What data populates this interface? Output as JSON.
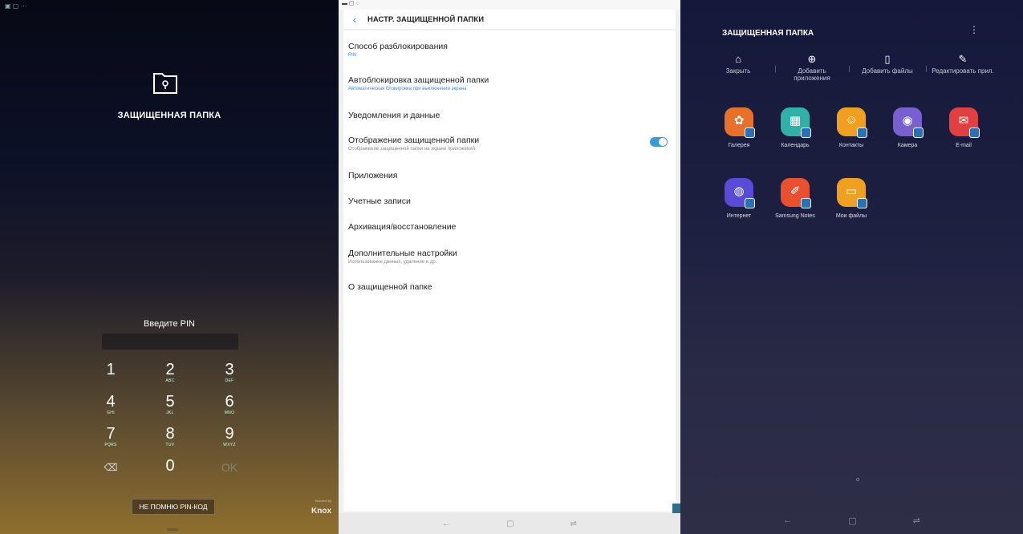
{
  "lock": {
    "title": "ЗАЩИЩЕННАЯ ПАПКА",
    "pin_prompt": "Введите PIN",
    "keys": [
      {
        "digit": "1",
        "letters": ""
      },
      {
        "digit": "2",
        "letters": "ABC"
      },
      {
        "digit": "3",
        "letters": "DEF"
      },
      {
        "digit": "4",
        "letters": "GHI"
      },
      {
        "digit": "5",
        "letters": "JKL"
      },
      {
        "digit": "6",
        "letters": "MNO"
      },
      {
        "digit": "7",
        "letters": "PQRS"
      },
      {
        "digit": "8",
        "letters": "TUV"
      },
      {
        "digit": "9",
        "letters": "WXYZ"
      },
      {
        "digit": "⌫",
        "letters": ""
      },
      {
        "digit": "0",
        "letters": ""
      },
      {
        "digit": "OK",
        "letters": ""
      }
    ],
    "forgot_label": "НЕ ПОМНЮ PIN-КОД",
    "knox_small": "Secured by",
    "knox_brand": "Knox",
    "colors": {
      "top": "#070915",
      "bottom": "#8f6f2f"
    }
  },
  "settings": {
    "title": "НАСТР. ЗАЩИЩЕННОЙ ПАПКИ",
    "items": [
      {
        "title": "Способ разблокирования",
        "subtitle": "PIN"
      },
      {
        "title": "Автоблокировка защищенной папки",
        "subtitle": "Автоматическая блокировка при выключении экрана"
      },
      {
        "title": "Уведомления и данные",
        "subtitle": ""
      },
      {
        "title": "Отображение защищенной папки",
        "subtitle": "Отображение защищенной папки на экране приложений."
      },
      {
        "title": "Приложения",
        "subtitle": ""
      },
      {
        "title": "Учетные записи",
        "subtitle": ""
      },
      {
        "title": "Архивация/восстановление",
        "subtitle": ""
      },
      {
        "title": "Дополнительные настройки",
        "subtitle": "Использование данных, удаление и др."
      },
      {
        "title": "О защищенной папке",
        "subtitle": ""
      }
    ],
    "toggle_on": true,
    "accent": "#3a8bd8"
  },
  "home": {
    "title": "ЗАЩИЩЕННАЯ ПАПКА",
    "actions": [
      {
        "label": "Закрыть",
        "icon": "lock-icon"
      },
      {
        "label": "Добавить приложения",
        "icon": "add-circle-icon"
      },
      {
        "label": "Добавить файлы",
        "icon": "file-icon"
      },
      {
        "label": "Редактировать прил.",
        "icon": "pencil-icon"
      }
    ],
    "apps": [
      {
        "name": "Галерея",
        "icon": "gallery-icon",
        "color": "#e8702a"
      },
      {
        "name": "Календарь",
        "icon": "calendar-icon",
        "color": "#2fb0a8"
      },
      {
        "name": "Контакты",
        "icon": "contacts-icon",
        "color": "#f0a020"
      },
      {
        "name": "Камера",
        "icon": "camera-icon",
        "color": "#7a5fd0"
      },
      {
        "name": "E-mail",
        "icon": "email-icon",
        "color": "#e04040"
      },
      {
        "name": "Интернет",
        "icon": "internet-icon",
        "color": "#5a4ad8"
      },
      {
        "name": "Samsung Notes",
        "icon": "notes-icon",
        "color": "#e85030"
      },
      {
        "name": "Мои файлы",
        "icon": "my-files-icon",
        "color": "#f0a020"
      }
    ]
  }
}
